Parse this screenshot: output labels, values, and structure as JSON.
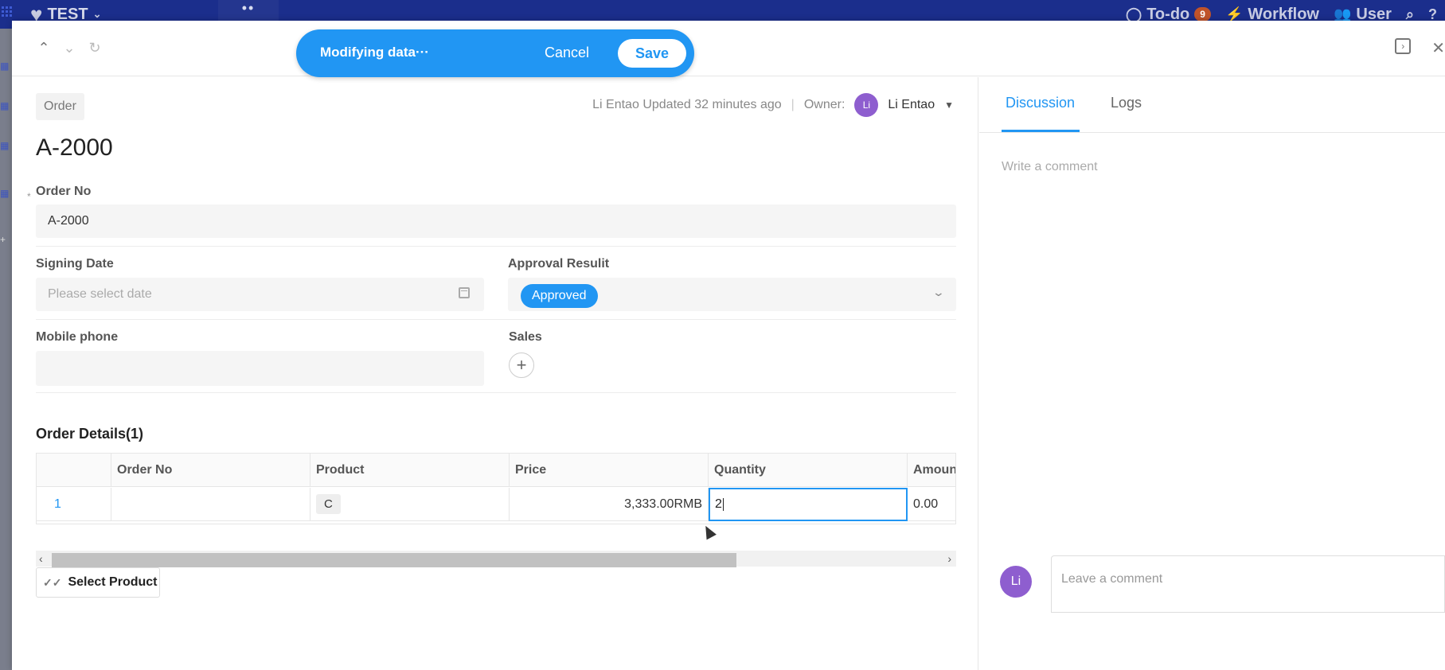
{
  "appbar": {
    "brand": "TEST",
    "dots": "••",
    "todo_label": "To-do",
    "todo_count": "9",
    "workflow_label": "Workflow",
    "user_label": "User"
  },
  "edit_bar": {
    "message": "Modifying data···",
    "cancel_label": "Cancel",
    "save_label": "Save"
  },
  "record": {
    "worksheet_tag": "Order",
    "title": "A-2000",
    "updated_by": "Li Entao",
    "updated_text": "Updated 32 minutes ago",
    "owner_label": "Owner:",
    "owner_avatar": "Li",
    "owner_name": "Li Entao"
  },
  "fields": {
    "order_no_label": "Order No",
    "order_no_value": "A-2000",
    "signing_date_label": "Signing Date",
    "signing_date_placeholder": "Please select date",
    "approval_label": "Approval Resulit",
    "approval_value": "Approved",
    "mobile_label": "Mobile phone",
    "sales_label": "Sales"
  },
  "details": {
    "title": "Order Details(1)",
    "columns": [
      "",
      "Order No",
      "Product",
      "Price",
      "Quantity",
      "Amoun"
    ],
    "rows": [
      {
        "num": "1",
        "order_no": "",
        "product": "C",
        "price": "3,333.00RMB",
        "quantity": "2",
        "amount": "0.00"
      }
    ],
    "select_product_label": "Select Product"
  },
  "side": {
    "tab_discussion": "Discussion",
    "tab_logs": "Logs",
    "write_comment": "Write a comment",
    "avatar": "Li",
    "leave_comment": "Leave a comment"
  },
  "colors": {
    "accent": "#2196f3",
    "appbar": "#1b2e8c",
    "avatar": "#8e5ecf"
  }
}
